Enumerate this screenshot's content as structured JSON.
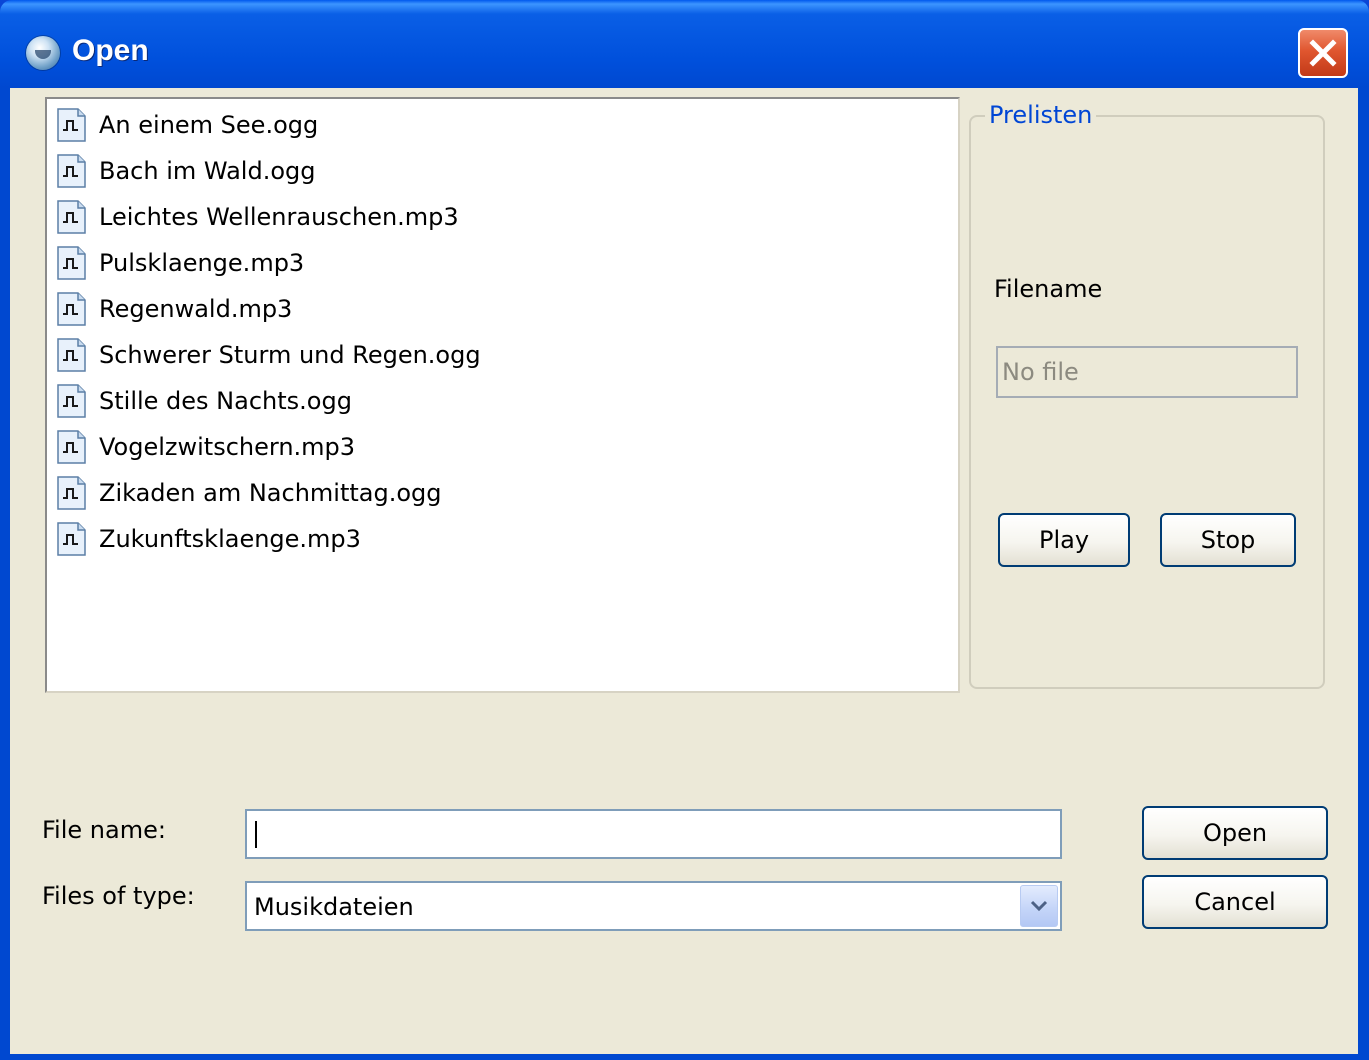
{
  "window": {
    "title": "Open",
    "icon": "app-globe-icon",
    "close_icon": "close-icon"
  },
  "file_list": {
    "item_icon": "audio-file-icon",
    "items": [
      {
        "name": "An einem See.ogg"
      },
      {
        "name": "Bach im Wald.ogg"
      },
      {
        "name": "Leichtes Wellenrauschen.mp3"
      },
      {
        "name": "Pulsklaenge.mp3"
      },
      {
        "name": "Regenwald.mp3"
      },
      {
        "name": "Schwerer Sturm und Regen.ogg"
      },
      {
        "name": "Stille des Nachts.ogg"
      },
      {
        "name": "Vogelzwitschern.mp3"
      },
      {
        "name": "Zikaden am Nachmittag.ogg"
      },
      {
        "name": "Zukunftsklaenge.mp3"
      }
    ]
  },
  "prelisten": {
    "title": "Prelisten",
    "filename_label": "Filename",
    "filename_value": "No file",
    "play_label": "Play",
    "stop_label": "Stop"
  },
  "form": {
    "file_name_label": "File name:",
    "file_name_value": "",
    "files_of_type_label": "Files of type:",
    "files_of_type_value": "Musikdateien"
  },
  "buttons": {
    "open_label": "Open",
    "cancel_label": "Cancel"
  },
  "colors": {
    "titlebar": "#0054e3",
    "dialog_background": "#ece9d8",
    "group_title": "#0046d5",
    "close_button": "#e0562f"
  }
}
